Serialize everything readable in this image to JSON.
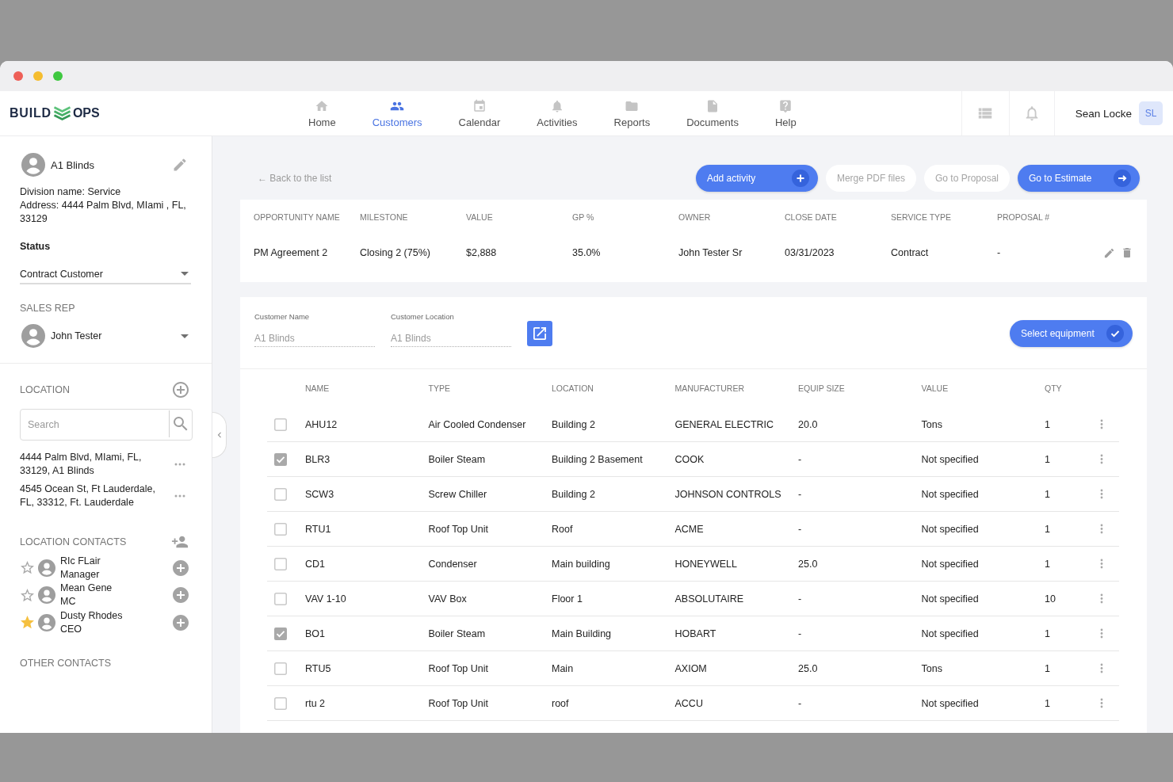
{
  "header": {
    "logo": [
      "BUILD",
      "OPS"
    ],
    "nav": [
      {
        "label": "Home",
        "selected": false
      },
      {
        "label": "Customers",
        "selected": true
      },
      {
        "label": "Calendar",
        "selected": false
      },
      {
        "label": "Activities",
        "selected": false
      },
      {
        "label": "Reports",
        "selected": false
      },
      {
        "label": "Documents",
        "selected": false
      },
      {
        "label": "Help",
        "selected": false
      }
    ],
    "user": {
      "name": "Sean Locke",
      "initials": "SL"
    }
  },
  "sidebar": {
    "customer": {
      "name": "A1 Blinds",
      "details": [
        "Division name: Service",
        "Address: 4444 Palm Blvd, MIami , FL, 33129"
      ]
    },
    "status": {
      "label": "Status",
      "value": "Contract Customer"
    },
    "sales_rep": {
      "label": "SALES REP",
      "value": "John Tester"
    },
    "location": {
      "title": "LOCATION",
      "search": {
        "placeholder": "Search"
      },
      "items": [
        "4444 Palm Blvd, MIami, FL, 33129, A1 Blinds",
        "4545 Ocean St, Ft Lauderdale, FL, 33312, Ft. Lauderdale"
      ]
    },
    "location_contacts": {
      "title": "LOCATION CONTACTS",
      "items": [
        {
          "name": "RIc FLair",
          "role": "Manager",
          "starred": false
        },
        {
          "name": "Mean Gene",
          "role": "MC",
          "starred": false
        },
        {
          "name": "Dusty Rhodes",
          "role": "CEO",
          "starred": true
        }
      ]
    },
    "other_contacts": {
      "title": "OTHER CONTACTS"
    }
  },
  "toolbar": {
    "back_link": "← Back to the list",
    "actions": [
      {
        "label": "Add activity",
        "kind": "primary"
      },
      {
        "label": "Merge PDF files",
        "kind": "secondary"
      },
      {
        "label": "Go to Proposal",
        "kind": "secondary"
      },
      {
        "label": "Go to Estimate",
        "kind": "primary"
      }
    ]
  },
  "opportunity": {
    "columns": [
      "OPPORTUNITY NAME",
      "MILESTONE",
      "VALUE",
      "GP %",
      "OWNER",
      "CLOSE DATE",
      "SERVICE TYPE",
      "PROPOSAL #"
    ],
    "values": [
      "PM Agreement 2",
      "Closing 2 (75%)",
      "$2,888",
      "35.0%",
      "John Tester Sr",
      "03/31/2023",
      "Contract",
      "-"
    ]
  },
  "equipment": {
    "fields": [
      {
        "label": "Customer Name",
        "value": "A1 Blinds",
        "disabled": true
      },
      {
        "label": "Customer Location",
        "value": "A1 Blinds",
        "disabled": true
      }
    ],
    "select_button": "Select equipment",
    "table": {
      "columns": [
        "NAME",
        "TYPE",
        "LOCATION",
        "MANUFACTURER",
        "EQUIP SIZE",
        "VALUE",
        "QTY"
      ],
      "rows": [
        {
          "checked": false,
          "cells": [
            "AHU12",
            "Air Cooled Condenser",
            "Building 2",
            "GENERAL ELECTRIC",
            "20.0",
            "Tons",
            "1"
          ]
        },
        {
          "checked": true,
          "cells": [
            "BLR3",
            "Boiler Steam",
            "Building 2 Basement",
            "COOK",
            "-",
            "Not specified",
            "1"
          ]
        },
        {
          "checked": false,
          "cells": [
            "SCW3",
            "Screw Chiller",
            "Building 2",
            "JOHNSON CONTROLS",
            "-",
            "Not specified",
            "1"
          ]
        },
        {
          "checked": false,
          "cells": [
            "RTU1",
            "Roof Top Unit",
            "Roof",
            "ACME",
            "-",
            "Not specified",
            "1"
          ]
        },
        {
          "checked": false,
          "cells": [
            "CD1",
            "Condenser",
            "Main building",
            "HONEYWELL",
            "25.0",
            "Not specified",
            "1"
          ]
        },
        {
          "checked": false,
          "cells": [
            "VAV 1-10",
            "VAV Box",
            "Floor 1",
            "ABSOLUTAIRE",
            "-",
            "Not specified",
            "10"
          ]
        },
        {
          "checked": true,
          "cells": [
            "BO1",
            "Boiler Steam",
            "Main Building",
            "HOBART",
            "-",
            "Not specified",
            "1"
          ]
        },
        {
          "checked": false,
          "cells": [
            "RTU5",
            "Roof Top Unit",
            "Main",
            "AXIOM",
            "25.0",
            "Tons",
            "1"
          ]
        },
        {
          "checked": false,
          "cells": [
            "rtu 2",
            "Roof Top Unit",
            "roof",
            "ACCU",
            "-",
            "Not specified",
            "1"
          ]
        }
      ]
    }
  }
}
